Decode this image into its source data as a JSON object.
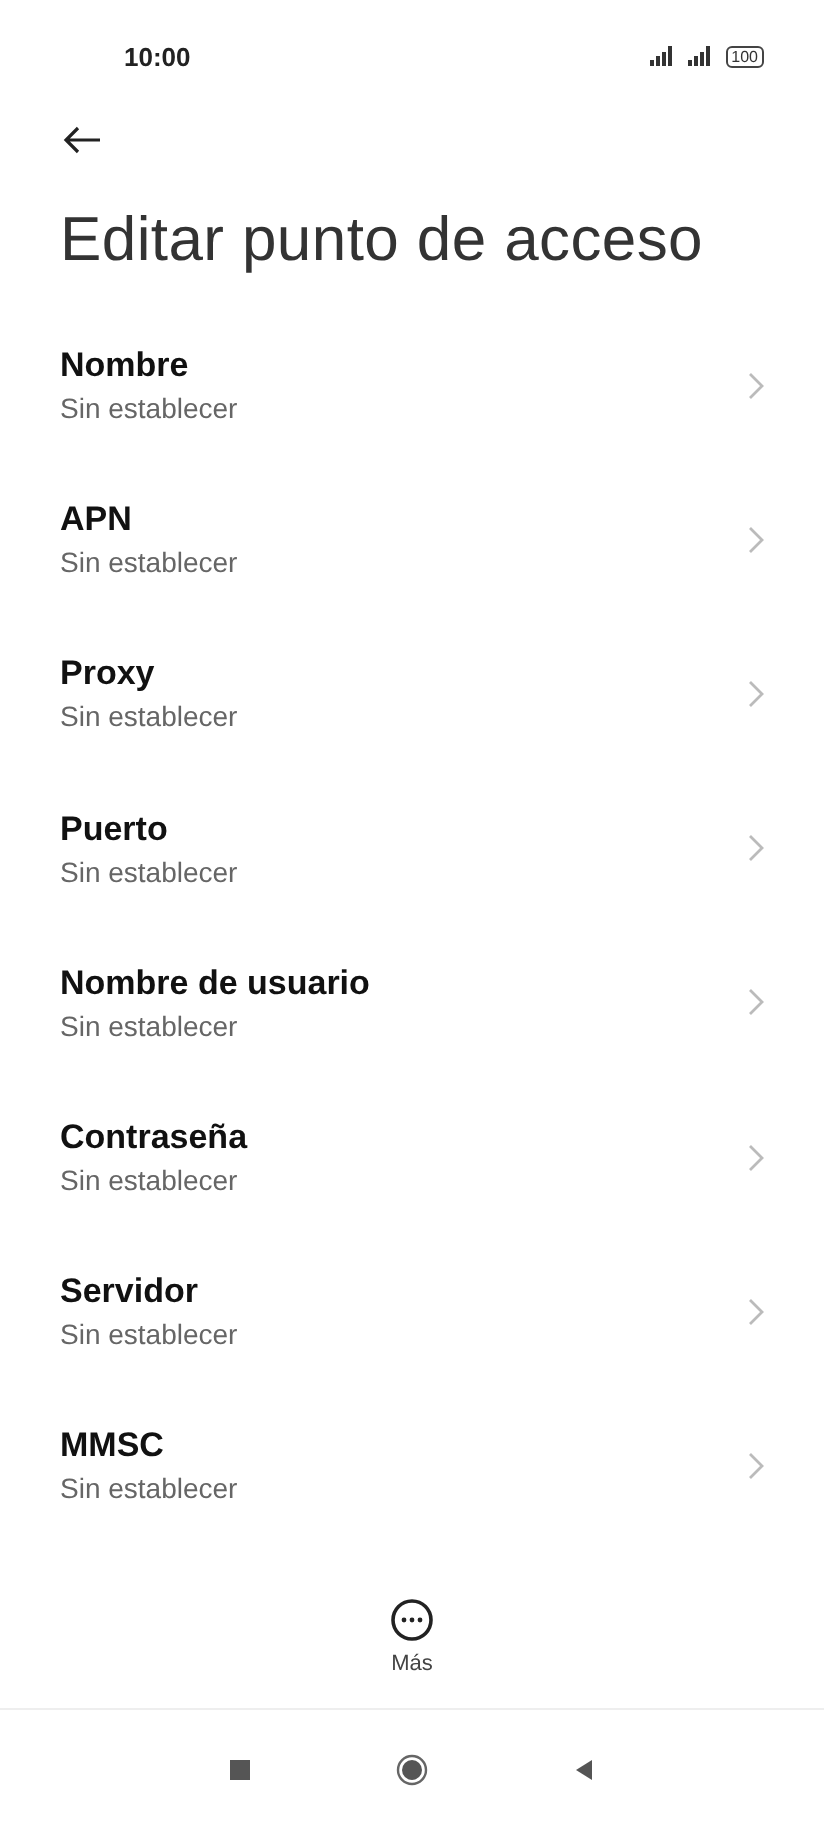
{
  "status_bar": {
    "time": "10:00",
    "battery": "100"
  },
  "title": "Editar punto de acceso",
  "items": [
    {
      "label": "Nombre",
      "value": "Sin establecer"
    },
    {
      "label": "APN",
      "value": "Sin establecer"
    },
    {
      "label": "Proxy",
      "value": "Sin establecer"
    },
    {
      "label": "Puerto",
      "value": "Sin establecer"
    },
    {
      "label": "Nombre de usuario",
      "value": "Sin establecer"
    },
    {
      "label": "Contraseña",
      "value": "Sin establecer"
    },
    {
      "label": "Servidor",
      "value": "Sin establecer"
    },
    {
      "label": "MMSC",
      "value": "Sin establecer"
    }
  ],
  "more_button": {
    "label": "Más"
  }
}
